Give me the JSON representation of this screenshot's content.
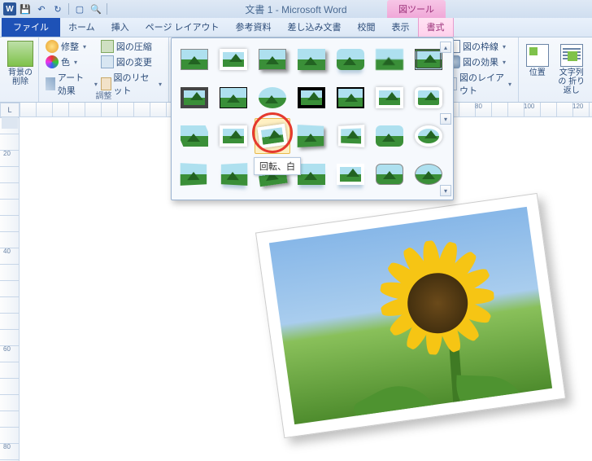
{
  "title": "文書 1 - Microsoft Word",
  "context_tool_label": "図ツール",
  "qat": {
    "app_letter": "W"
  },
  "tabs": {
    "file": "ファイル",
    "items": [
      "ホーム",
      "挿入",
      "ページ レイアウト",
      "参考資料",
      "差し込み文書",
      "校閲",
      "表示"
    ],
    "active": "書式"
  },
  "ribbon": {
    "remove_bg": "背景の\n削除",
    "corrections": "修整",
    "color": "色",
    "artistic": "アート効果",
    "compress": "図の圧縮",
    "change": "図の変更",
    "reset": "図のリセット",
    "adjust_group": "調整",
    "border": "図の枠線",
    "effects": "図の効果",
    "layout": "図のレイアウト",
    "position": "位置",
    "wrap": "文字列の\n折り返し"
  },
  "gallery": {
    "tooltip": "回転、白"
  },
  "ruler_h_marks": [
    "80",
    "100",
    "120"
  ],
  "ruler_v_marks": [
    "20",
    "",
    "",
    "",
    "40",
    "",
    "",
    "",
    "60",
    "",
    "",
    "",
    "80"
  ],
  "chart_data": null
}
